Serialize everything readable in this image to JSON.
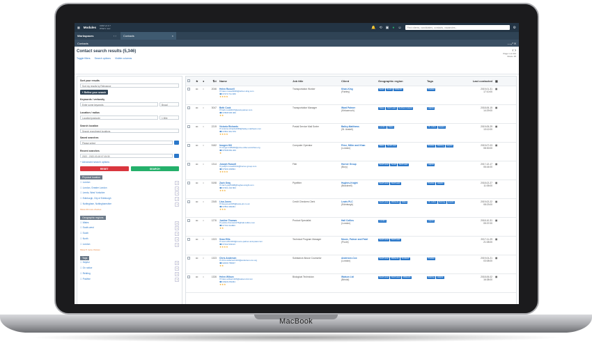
{
  "device_label": "MacBook",
  "topbar": {
    "modules_label": "Modules",
    "version": "CRM v2.3.7",
    "version_sub": "What's new",
    "search_placeholder": "Find clients, candidates, contacts, vacancies..."
  },
  "tabbar": {
    "workspaces": "Workspaces",
    "tab": "Contacts"
  },
  "titlebar": {
    "title": "Contacts"
  },
  "header": {
    "title": "Contact search results (5,346)",
    "links": [
      "Toggle filters",
      "Search options",
      "Visible columns"
    ],
    "pager": "Page 1 of 214",
    "pager_sub": "Rows: 25"
  },
  "panel": {
    "sort_title": "Sort your results",
    "sort_value": "Sort my results by Relevance",
    "refine": "+ Refine your search",
    "keywords_label": "Keywords / verbosity",
    "keywords_placeholder": "Enter some keywords",
    "broad": "Broad",
    "location_label": "Location / radius",
    "location_placeholder": "Location/postcode",
    "radius": "1 Mile",
    "search_location_label": "Search location",
    "search_location_value": "Search recruitment locations",
    "saved_label": "Saved searches",
    "saved_placeholder": "Please select",
    "recent_label": "Recent searches",
    "recent_value": "2022 - 2022-03-18 07:15:30",
    "advanced": "+ Advanced search options",
    "reset": "RESET",
    "search": "SEARCH",
    "physical_title": "Physical location",
    "physical": [
      {
        "label": "London",
        "count": "2"
      },
      {
        "label": "London, Greater London",
        "count": "1"
      },
      {
        "label": "Leeds, West Yorkshire",
        "count": "1"
      },
      {
        "label": "Edinburgh, City of Edinburgh",
        "count": "1"
      },
      {
        "label": "Nottingham, Nottinghamshire",
        "count": "1"
      }
    ],
    "physical_more": "Show 20 more choices",
    "geo_title": "Geographic regions",
    "geo": [
      {
        "label": "Wales",
        "count": "8"
      },
      {
        "label": "South-west",
        "count": "5"
      },
      {
        "label": "South",
        "count": "4"
      },
      {
        "label": "North",
        "count": "3"
      },
      {
        "label": "London",
        "count": "2"
      }
    ],
    "geo_more": "Show 5 more choices",
    "tags_title": "Tags",
    "tags": [
      {
        "label": "Helpful",
        "count": "8"
      },
      {
        "label": "On notice",
        "count": "6"
      },
      {
        "label": "Retiring",
        "count": "5"
      },
      {
        "label": "Positive",
        "count": "4"
      }
    ]
  },
  "table": {
    "headers": [
      "Name",
      "Job title",
      "Client",
      "Geographic region",
      "Tags",
      "Last contacted"
    ],
    "rows": [
      {
        "id": "2046",
        "name": "Helen Russell",
        "email": "helen.russell2046@lehner-king.com",
        "phone": "07473 711 389",
        "stars": "★★★★",
        "job": "Transportation Worker",
        "client": "Khan-King",
        "client_sub": "(Fairley)",
        "regions": [
          "South",
          "South",
          "Midlands"
        ],
        "tags": [
          "Positive"
        ],
        "date": "2019-01-31",
        "time": "17:10:00"
      },
      {
        "id": "3047",
        "name": "Beth Cook",
        "email": "beth.cook3047@ward-palmer.com",
        "phone": "07808 535 066",
        "stars": "★★",
        "job": "Transportation Manager",
        "client": "Ward Palmer",
        "client_sub": "(Kirkcarroch)",
        "regions": [
          "Wales",
          "North east",
          "Northern Ireland"
        ],
        "tags": [
          "Helpful"
        ],
        "date": "2018-06-15",
        "time": "14:29:00"
      },
      {
        "id": "2219",
        "name": "Victoria Richards",
        "email": "victoria.richards2039@bailey-matthews.com",
        "phone": "07801 961 879",
        "stars": "★★★★",
        "job": "Postal Service Mail Sorter",
        "client": "Bailey-Matthews",
        "client_sub": "(St. Austell)",
        "regions": [
          "London",
          "Wales"
        ],
        "tags": [
          "On notice",
          "Helpful"
        ],
        "date": "2019-05-29",
        "time": "13:12:00"
      },
      {
        "id": "5182",
        "name": "Imogen Hill",
        "email": "imogen.hill5182@price-miller-and-khan.org",
        "phone": "07538 652 209",
        "stars": "★",
        "job": "Computer Operator",
        "client": "Price, Miller and Khan",
        "client_sub": "(London)",
        "regions": [
          "Wales",
          "South east"
        ],
        "tags": [
          "Positive",
          "Retiring",
          "Helpful"
        ],
        "date": "2019-07-03",
        "time": "08:30:00"
      },
      {
        "id": "1314",
        "name": "Joseph Russell",
        "email": "joseph.russell1314@horner-group.com",
        "phone": "07909 493894",
        "stars": "★★★★",
        "job": "Filer",
        "client": "Horner Group",
        "client_sub": "(Bury)",
        "regions": [
          "South west",
          "South",
          "North east"
        ],
        "tags": [
          "Helpful"
        ],
        "date": "2017-12-17",
        "time": "06:44:00"
      },
      {
        "id": "5198",
        "name": "Zach Gray",
        "email": "zach.gray5198@hughes-knight.com",
        "phone": "07401 232 803",
        "stars": "★★★",
        "job": "Pipefitter",
        "client": "Hughes-Knight",
        "client_sub": "(Bracknell)",
        "regions": [
          "South west",
          "North east"
        ],
        "tags": [
          "Positive",
          "Helpful"
        ],
        "date": "2018-02-27",
        "time": "11:05:00"
      },
      {
        "id": "2345",
        "name": "Lisa Jones",
        "email": "lisa.jones2345@lewis-plc.co.uk",
        "phone": "07853 484464",
        "stars": "★★★",
        "job": "Credit Checkers Clerk",
        "client": "Lewis PLC",
        "client_sub": "(Edinburgh)",
        "regions": [
          "South west",
          "Midlands",
          "Wales"
        ],
        "tags": [
          "On notice",
          "Retiring",
          "Helpful"
        ],
        "date": "2019-02-22",
        "time": "08:23:00"
      },
      {
        "id": "1276",
        "name": "Justine Thomas",
        "email": "justine.thomas1276@hall-collins.com",
        "phone": "07701 611863",
        "stars": "★★",
        "job": "Product Specialist",
        "client": "Hall Collins",
        "client_sub": "(London)",
        "regions": [
          "London"
        ],
        "tags": [
          "Helpful"
        ],
        "date": "2018-10-31",
        "time": "05:37:00"
      },
      {
        "id": "1323",
        "name": "Sean Ellis",
        "email": "sean.ellis1323@moore-palmer-and-patel.com",
        "phone": "07442 619113",
        "stars": "★★★★",
        "job": "Technical Program Manager",
        "client": "Moore, Palmer and Patel",
        "client_sub": "(Poole)",
        "regions": [
          "South west",
          "North east"
        ],
        "tags": [],
        "date": "2017-11-29",
        "time": "21:08:00"
      },
      {
        "id": "1323",
        "name": "Chris Andersen",
        "email": "chris.andersen1323@andersen-cox.org",
        "phone": "02009 765007",
        "stars": "★★",
        "job": "Substance Abuse Counselor",
        "client": "Andersen-Cox",
        "client_sub": "(London)",
        "regions": [
          "South west",
          "Midlands",
          "Scotland"
        ],
        "tags": [
          "Positive"
        ],
        "date": "2019-04-21",
        "time": "03:08:00"
      },
      {
        "id": "1326",
        "name": "Helen Wilson",
        "email": "helen.wilson1326@watson-ltd.com",
        "phone": "03929 254464",
        "stars": "★★★",
        "job": "Biological Technician",
        "client": "Watson Ltd",
        "client_sub": "(Bristol)",
        "regions": [
          "South west",
          "North west",
          "Midlands"
        ],
        "tags": [
          "Retiring",
          "Helpful"
        ],
        "date": "2018-06-02",
        "time": "16:38:00"
      }
    ]
  },
  "colors": {
    "topbar": "#233444",
    "accent": "#2a77c9",
    "reset": "#d9363e",
    "search": "#25b06b",
    "stars": "#f1a31b"
  }
}
